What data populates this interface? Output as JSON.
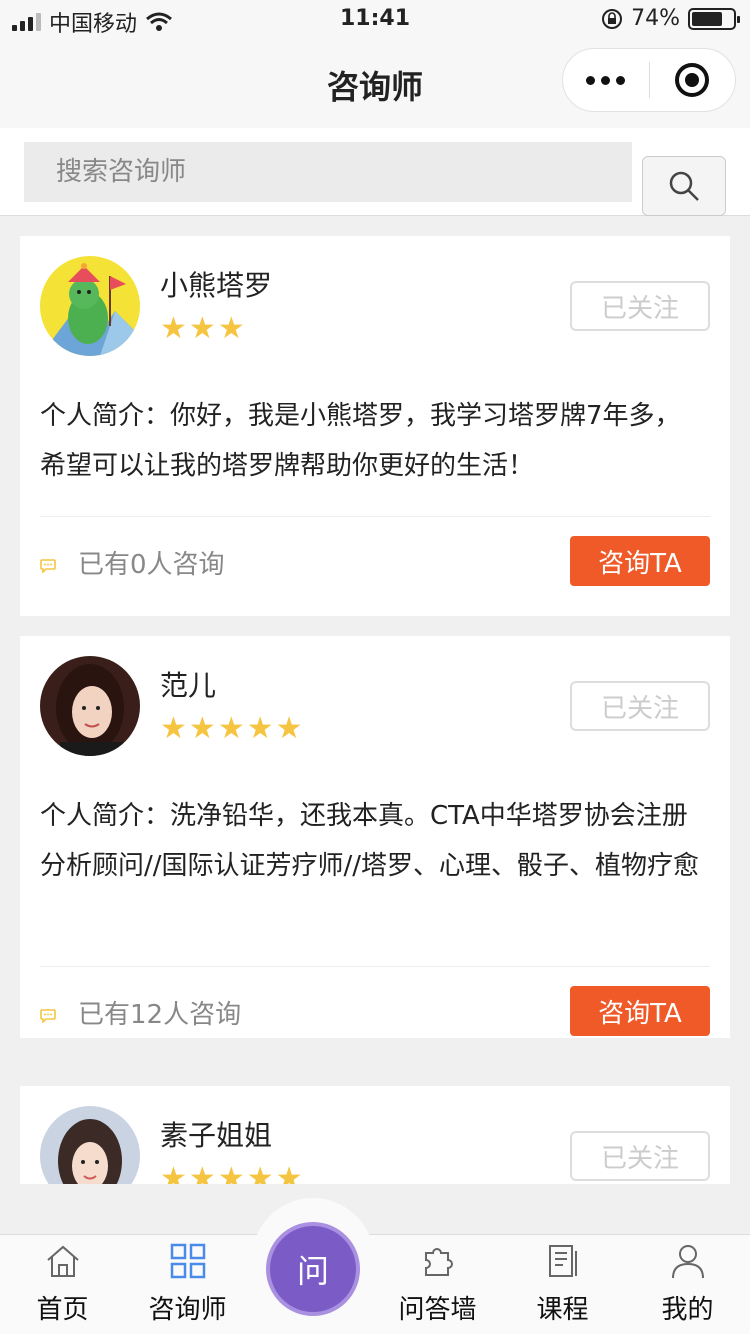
{
  "status_bar": {
    "carrier": "中国移动",
    "time": "11:41",
    "battery": "74%",
    "battery_level": 0.74
  },
  "nav": {
    "title": "咨询师"
  },
  "search": {
    "placeholder": "搜索咨询师"
  },
  "counselors": [
    {
      "name": "小熊塔罗",
      "rating": 3,
      "follow_label": "已关注",
      "intro": "个人简介：你好，我是小熊塔罗，我学习塔罗牌7年多，希望可以让我的塔罗牌帮助你更好的生活！",
      "consult_count": "已有0人咨询",
      "consult_label": "咨询TA"
    },
    {
      "name": "范儿",
      "rating": 5,
      "follow_label": "已关注",
      "intro": "个人简介：洗净铅华，还我本真。CTA中华塔罗协会注册分析顾问//国际认证芳疗师//塔罗、心理、骰子、植物疗愈",
      "consult_count": "已有12人咨询",
      "consult_label": "咨询TA"
    },
    {
      "name": "素子姐姐",
      "rating": 5,
      "follow_label": "已关注"
    }
  ],
  "tabbar": {
    "home": "首页",
    "counselor": "咨询师",
    "center": "问",
    "qa_wall": "问答墙",
    "courses": "课程",
    "mine": "我的"
  },
  "colors": {
    "accent": "#ef5a28",
    "star": "#f5c542",
    "center": "#7b5cc6"
  }
}
